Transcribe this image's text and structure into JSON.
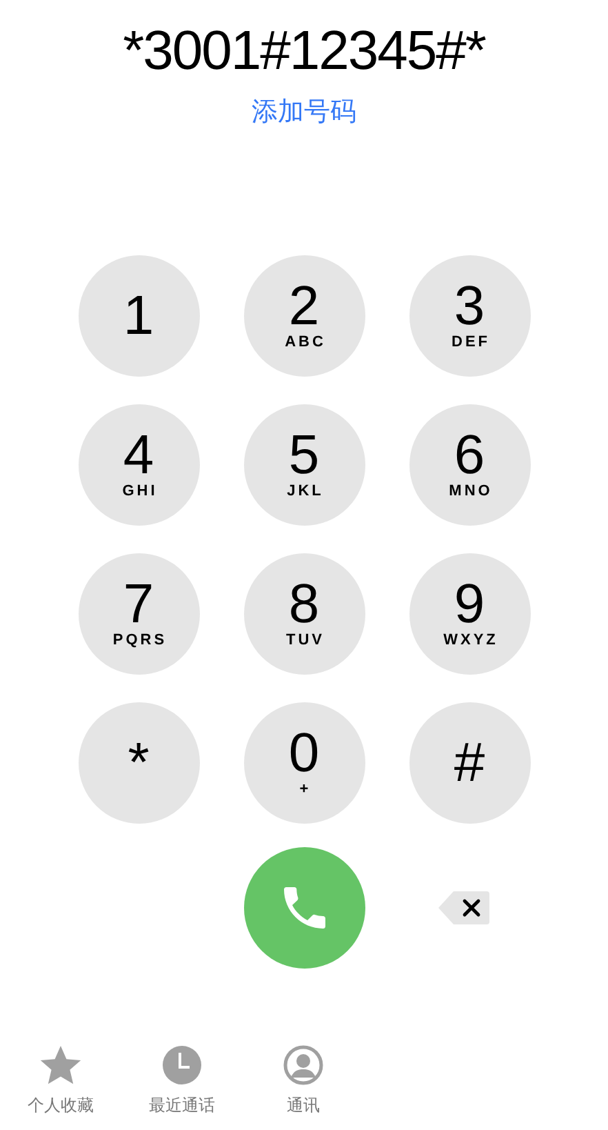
{
  "number": "*3001#12345#*",
  "add_number": "添加号码",
  "keys": [
    {
      "digit": "1"
    },
    {
      "digit": "2",
      "letters": "ABC"
    },
    {
      "digit": "3",
      "letters": "DEF"
    },
    {
      "digit": "4",
      "letters": "GHI"
    },
    {
      "digit": "5",
      "letters": "JKL"
    },
    {
      "digit": "6",
      "letters": "MNO"
    },
    {
      "digit": "7",
      "letters": "PQRS"
    },
    {
      "digit": "8",
      "letters": "TUV"
    },
    {
      "digit": "9",
      "letters": "WXYZ"
    },
    {
      "digit": "*"
    },
    {
      "digit": "0",
      "letters": "+"
    },
    {
      "digit": "#"
    }
  ],
  "tabs": [
    {
      "label": "个人收藏",
      "kind": "star",
      "selected": false
    },
    {
      "label": "最近通话",
      "kind": "clock",
      "selected": false
    },
    {
      "label": "通讯",
      "kind": "contact",
      "selected": false
    }
  ]
}
